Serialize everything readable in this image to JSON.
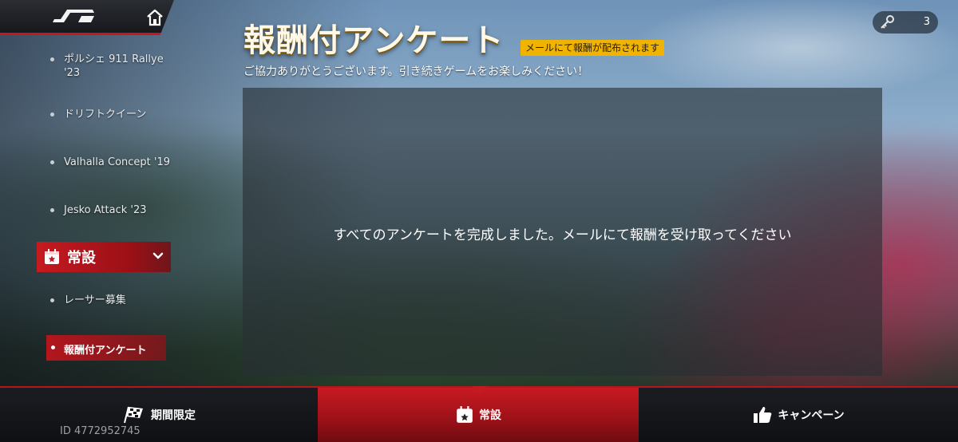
{
  "page": {
    "title": "報酬付アンケート",
    "mail_badge": "メールにて報酬が配布されます",
    "subtitle": "ご協力ありがとうございます。引き続きゲームをお楽しみください！"
  },
  "counter": {
    "icon": "key-icon",
    "value": "3"
  },
  "sidebar": {
    "items": [
      {
        "label": "ポルシェ 911 Rallye '23"
      },
      {
        "label": "ドリフトクイーン"
      },
      {
        "label": "Valhalla Concept '19"
      },
      {
        "label": "Jesko Attack '23"
      }
    ],
    "section": {
      "label": "常設",
      "icon": "calendar-star-icon"
    },
    "sub_items": [
      {
        "label": "レーサー募集"
      },
      {
        "label": "報酬付アンケート",
        "active": true
      }
    ]
  },
  "panel": {
    "message": "すべてのアンケートを完成しました。メールにて報酬を受け取ってください"
  },
  "bottom_tabs": [
    {
      "label": "期間限定",
      "icon": "checkered-flag-icon"
    },
    {
      "label": "常設",
      "icon": "calendar-star-icon",
      "active": true
    },
    {
      "label": "キャンペーン",
      "icon": "thumbs-up-icon"
    }
  ],
  "user": {
    "id": "ID 4772952745"
  },
  "colors": {
    "accent_red": "#c61a21",
    "badge_yellow": "#f0b400"
  }
}
